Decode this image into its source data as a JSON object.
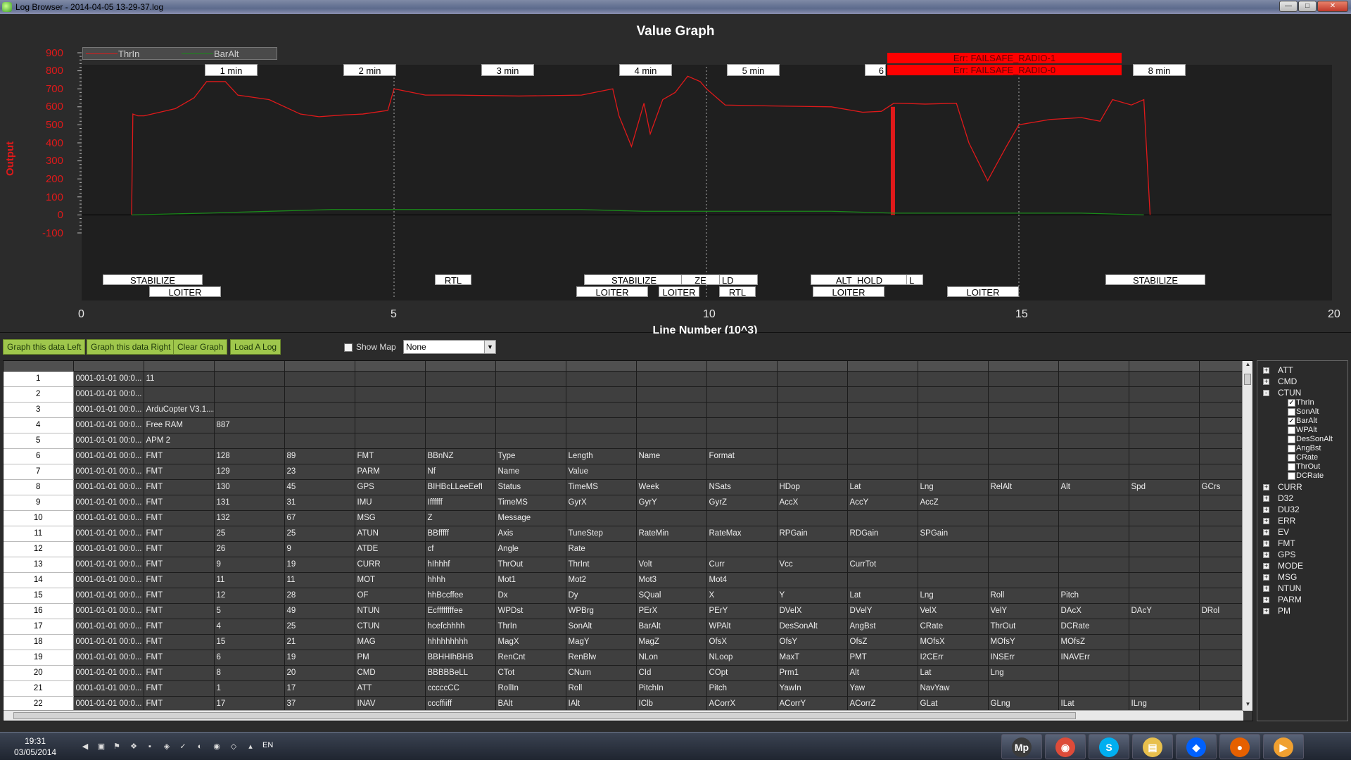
{
  "window": {
    "title": "Log Browser - 2014-04-05 13-29-37.log",
    "buttons": {
      "minimize": "—",
      "maximize": "□",
      "close": "✕"
    }
  },
  "graph": {
    "title": "Value Graph",
    "ylabel": "Output",
    "xlabel": "Line Number (10^3)",
    "legend": [
      {
        "name": "ThrIn",
        "color": "#e0191a"
      },
      {
        "name": "BarAlt",
        "color": "#1a8a1a"
      }
    ],
    "y_ticks": [
      "900",
      "800",
      "700",
      "600",
      "500",
      "400",
      "300",
      "200",
      "100",
      "0",
      "-100"
    ],
    "x_ticks": [
      "0",
      "5",
      "10",
      "15",
      "20"
    ],
    "time_labels": [
      "1 min",
      "2 min",
      "3 min",
      "4 min",
      "5 min",
      "6",
      "8 min"
    ],
    "errors": [
      "Err: FAILSAFE_RADIO-1",
      "Err: FAILSAFE_RADIO-0"
    ],
    "mode_labels_top": [
      "STABILIZE",
      "RTL",
      "STABILIZE",
      "ZE",
      "LD",
      "ALT_HOLD",
      "L",
      "STABILIZE"
    ],
    "mode_labels_bottom": [
      "LOITER",
      "LOITER",
      "LOITER",
      "RTL",
      "LOITER",
      "LOITER"
    ]
  },
  "chart_data": {
    "type": "line",
    "title": "Value Graph",
    "xlabel": "Line Number (10^3)",
    "ylabel": "Output",
    "xlim": [
      0,
      20
    ],
    "ylim": [
      -100,
      900
    ],
    "grid": false,
    "legend_position": "top-left",
    "series": [
      {
        "name": "ThrIn",
        "color": "#e0191a",
        "x": [
          0.8,
          0.82,
          0.9,
          1.0,
          1.5,
          1.8,
          2.0,
          2.3,
          2.5,
          3.0,
          3.5,
          3.8,
          4.2,
          4.5,
          4.9,
          5.0,
          5.5,
          6.0,
          7.0,
          8.0,
          8.5,
          8.6,
          8.8,
          9.0,
          9.1,
          9.3,
          9.5,
          9.7,
          9.9,
          10.0,
          10.3,
          11.0,
          12.0,
          12.5,
          12.8,
          13.0,
          13.1,
          13.5,
          14.0,
          14.2,
          14.5,
          14.8,
          15.0,
          15.5,
          16.0,
          16.3,
          16.5,
          16.8,
          17.0,
          17.1
        ],
        "y": [
          0,
          560,
          550,
          550,
          590,
          650,
          740,
          740,
          665,
          640,
          560,
          545,
          555,
          560,
          580,
          700,
          665,
          665,
          660,
          665,
          700,
          550,
          380,
          620,
          450,
          640,
          680,
          770,
          740,
          700,
          610,
          605,
          600,
          570,
          575,
          620,
          620,
          615,
          620,
          400,
          190,
          380,
          500,
          530,
          540,
          520,
          640,
          610,
          640,
          0
        ]
      },
      {
        "name": "BarAlt",
        "color": "#1a8a1a",
        "x": [
          0.8,
          2.0,
          4.0,
          6.0,
          8.0,
          9.0,
          10.0,
          11.0,
          12.0,
          13.0,
          14.0,
          15.0,
          16.0,
          17.0
        ],
        "y": [
          0,
          10,
          30,
          30,
          30,
          20,
          20,
          20,
          20,
          10,
          10,
          10,
          10,
          0
        ]
      }
    ]
  },
  "toolbar": {
    "graph_left": "Graph this data Left",
    "graph_right": "Graph this data Right",
    "clear": "Clear Graph",
    "load": "Load A Log",
    "show_map": "Show Map",
    "combo_value": "None"
  },
  "grid": {
    "rows": [
      [
        "1",
        "0001-01-01 00:0...",
        "11",
        "",
        "",
        "",
        "",
        "",
        "",
        "",
        "",
        "",
        "",
        "",
        "",
        "",
        ""
      ],
      [
        "2",
        "0001-01-01 00:0...",
        "",
        "",
        "",
        "",
        "",
        "",
        "",
        "",
        "",
        "",
        "",
        "",
        "",
        "",
        ""
      ],
      [
        "3",
        "0001-01-01 00:0...",
        "ArduCopter V3.1....",
        "",
        "",
        "",
        "",
        "",
        "",
        "",
        "",
        "",
        "",
        "",
        "",
        "",
        ""
      ],
      [
        "4",
        "0001-01-01 00:0...",
        "Free RAM",
        "887",
        "",
        "",
        "",
        "",
        "",
        "",
        "",
        "",
        "",
        "",
        "",
        "",
        ""
      ],
      [
        "5",
        "0001-01-01 00:0...",
        "APM 2",
        "",
        "",
        "",
        "",
        "",
        "",
        "",
        "",
        "",
        "",
        "",
        "",
        "",
        ""
      ],
      [
        "6",
        "0001-01-01 00:0...",
        "FMT",
        "128",
        "89",
        "FMT",
        "BBnNZ",
        "Type",
        "Length",
        "Name",
        "Format",
        "",
        "",
        "",
        "",
        "",
        ""
      ],
      [
        "7",
        "0001-01-01 00:0...",
        "FMT",
        "129",
        "23",
        "PARM",
        "Nf",
        "Name",
        "Value",
        "",
        "",
        "",
        "",
        "",
        "",
        "",
        ""
      ],
      [
        "8",
        "0001-01-01 00:0...",
        "FMT",
        "130",
        "45",
        "GPS",
        "BIHBcLLeeEefI",
        "Status",
        "TimeMS",
        "Week",
        "NSats",
        "HDop",
        "Lat",
        "Lng",
        "RelAlt",
        "Alt",
        "Spd",
        "GCrs"
      ],
      [
        "9",
        "0001-01-01 00:0...",
        "FMT",
        "131",
        "31",
        "IMU",
        "Iffffff",
        "TimeMS",
        "GyrX",
        "GyrY",
        "GyrZ",
        "AccX",
        "AccY",
        "AccZ",
        "",
        "",
        "",
        ""
      ],
      [
        "10",
        "0001-01-01 00:0...",
        "FMT",
        "132",
        "67",
        "MSG",
        "Z",
        "Message",
        "",
        "",
        "",
        "",
        "",
        "",
        "",
        "",
        "",
        ""
      ],
      [
        "11",
        "0001-01-01 00:0...",
        "FMT",
        "25",
        "25",
        "ATUN",
        "BBfffff",
        "Axis",
        "TuneStep",
        "RateMin",
        "RateMax",
        "RPGain",
        "RDGain",
        "SPGain",
        "",
        "",
        "",
        ""
      ],
      [
        "12",
        "0001-01-01 00:0...",
        "FMT",
        "26",
        "9",
        "ATDE",
        "cf",
        "Angle",
        "Rate",
        "",
        "",
        "",
        "",
        "",
        "",
        "",
        "",
        ""
      ],
      [
        "13",
        "0001-01-01 00:0...",
        "FMT",
        "9",
        "19",
        "CURR",
        "hIhhhf",
        "ThrOut",
        "ThrInt",
        "Volt",
        "Curr",
        "Vcc",
        "CurrTot",
        "",
        "",
        "",
        "",
        ""
      ],
      [
        "14",
        "0001-01-01 00:0...",
        "FMT",
        "11",
        "11",
        "MOT",
        "hhhh",
        "Mot1",
        "Mot2",
        "Mot3",
        "Mot4",
        "",
        "",
        "",
        "",
        "",
        "",
        ""
      ],
      [
        "15",
        "0001-01-01 00:0...",
        "FMT",
        "12",
        "28",
        "OF",
        "hhBccffee",
        "Dx",
        "Dy",
        "SQual",
        "X",
        "Y",
        "Lat",
        "Lng",
        "Roll",
        "Pitch",
        "",
        ""
      ],
      [
        "16",
        "0001-01-01 00:0...",
        "FMT",
        "5",
        "49",
        "NTUN",
        "Ecffffffffee",
        "WPDst",
        "WPBrg",
        "PErX",
        "PErY",
        "DVelX",
        "DVelY",
        "VelX",
        "VelY",
        "DAcX",
        "DAcY",
        "DRol"
      ],
      [
        "17",
        "0001-01-01 00:0...",
        "FMT",
        "4",
        "25",
        "CTUN",
        "hcefchhhh",
        "ThrIn",
        "SonAlt",
        "BarAlt",
        "WPAlt",
        "DesSonAlt",
        "AngBst",
        "CRate",
        "ThrOut",
        "DCRate",
        "",
        ""
      ],
      [
        "18",
        "0001-01-01 00:0...",
        "FMT",
        "15",
        "21",
        "MAG",
        "hhhhhhhhh",
        "MagX",
        "MagY",
        "MagZ",
        "OfsX",
        "OfsY",
        "OfsZ",
        "MOfsX",
        "MOfsY",
        "MOfsZ",
        "",
        ""
      ],
      [
        "19",
        "0001-01-01 00:0...",
        "FMT",
        "6",
        "19",
        "PM",
        "BBHHIhBHB",
        "RenCnt",
        "RenBlw",
        "NLon",
        "NLoop",
        "MaxT",
        "PMT",
        "I2CErr",
        "INSErr",
        "INAVErr",
        "",
        ""
      ],
      [
        "20",
        "0001-01-01 00:0...",
        "FMT",
        "8",
        "20",
        "CMD",
        "BBBBBeLL",
        "CTot",
        "CNum",
        "CId",
        "COpt",
        "Prm1",
        "Alt",
        "Lat",
        "Lng",
        "",
        "",
        ""
      ],
      [
        "21",
        "0001-01-01 00:0...",
        "FMT",
        "1",
        "17",
        "ATT",
        "cccccCC",
        "RollIn",
        "Roll",
        "PitchIn",
        "Pitch",
        "YawIn",
        "Yaw",
        "NavYaw",
        "",
        "",
        "",
        ""
      ],
      [
        "22",
        "0001-01-01 00:0...",
        "FMT",
        "17",
        "37",
        "INAV",
        "cccffiiff",
        "BAlt",
        "IAlt",
        "IClb",
        "ACorrX",
        "ACorrY",
        "ACorrZ",
        "GLat",
        "GLng",
        "ILat",
        "ILng",
        ""
      ]
    ]
  },
  "tree": {
    "nodes_before": [
      {
        "label": "ATT",
        "expander": "+"
      },
      {
        "label": "CMD",
        "expander": "+"
      },
      {
        "label": "CTUN",
        "expander": "-"
      }
    ],
    "ctun_children": [
      {
        "label": "ThrIn",
        "checked": true
      },
      {
        "label": "SonAlt",
        "checked": false
      },
      {
        "label": "BarAlt",
        "checked": true
      },
      {
        "label": "WPAlt",
        "checked": false
      },
      {
        "label": "DesSonAlt",
        "checked": false
      },
      {
        "label": "AngBst",
        "checked": false
      },
      {
        "label": "CRate",
        "checked": false
      },
      {
        "label": "ThrOut",
        "checked": false
      },
      {
        "label": "DCRate",
        "checked": false
      }
    ],
    "nodes_after": [
      {
        "label": "CURR",
        "expander": "+"
      },
      {
        "label": "D32",
        "expander": "+"
      },
      {
        "label": "DU32",
        "expander": "+"
      },
      {
        "label": "ERR",
        "expander": "+"
      },
      {
        "label": "EV",
        "expander": "+"
      },
      {
        "label": "FMT",
        "expander": "+"
      },
      {
        "label": "GPS",
        "expander": "+"
      },
      {
        "label": "MODE",
        "expander": "+"
      },
      {
        "label": "MSG",
        "expander": "+"
      },
      {
        "label": "NTUN",
        "expander": "+"
      },
      {
        "label": "PARM",
        "expander": "+"
      },
      {
        "label": "PM",
        "expander": "+"
      }
    ]
  },
  "taskbar": {
    "time": "19:31",
    "date": "03/05/2014",
    "lang": "EN",
    "apps": [
      {
        "name": "mission-planner",
        "glyph": "Mp"
      },
      {
        "name": "chrome",
        "glyph": "◉"
      },
      {
        "name": "skype",
        "glyph": "S"
      },
      {
        "name": "explorer",
        "glyph": "▤"
      },
      {
        "name": "dropbox",
        "glyph": "◆"
      },
      {
        "name": "firefox",
        "glyph": "●"
      },
      {
        "name": "media",
        "glyph": "▶"
      }
    ]
  }
}
